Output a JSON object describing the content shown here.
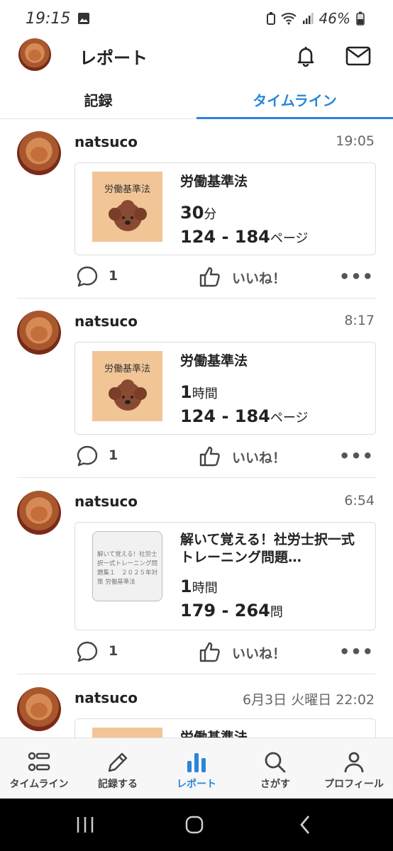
{
  "status_bar": {
    "time": "19:15",
    "battery": "46%"
  },
  "app_bar": {
    "title": "レポート",
    "icons": [
      "bell-icon",
      "mail-icon"
    ]
  },
  "tabs": [
    {
      "label": "記録",
      "active": false
    },
    {
      "label": "タイムライン",
      "active": true
    }
  ],
  "posts": [
    {
      "username": "natsuco",
      "time": "19:05",
      "cover_title": "労働基準法",
      "book_title": "労働基準法",
      "duration_value": "30",
      "duration_unit": "分",
      "range": "124 - 184",
      "range_unit": "ページ",
      "comments": "1",
      "like_label": "いいね！"
    },
    {
      "username": "natsuco",
      "time": "8:17",
      "cover_title": "労働基準法",
      "book_title": "労働基準法",
      "duration_value": "1",
      "duration_unit": "時間",
      "range": "124 - 184",
      "range_unit": "ページ",
      "comments": "1",
      "like_label": "いいね！"
    },
    {
      "username": "natsuco",
      "time": "6:54",
      "cover_title": "解いて覚える！社労士択一式トレーニング問題集１　２０２５年対策 労働基準法",
      "book_title": "解いて覚える！社労士択一式トレーニング問題…",
      "duration_value": "1",
      "duration_unit": "時間",
      "range": "179 - 264",
      "range_unit": "問",
      "comments": "1",
      "like_label": "いいね！"
    },
    {
      "username": "natsuco",
      "time": "6月3日 火曜日 22:02",
      "cover_title": "",
      "book_title": "労働基準法",
      "duration_value": "",
      "duration_unit": "",
      "range": "",
      "range_unit": "",
      "comments": "",
      "like_label": ""
    }
  ],
  "bottom_nav": [
    {
      "label": "タイムライン",
      "icon": "timeline-list-icon",
      "active": false
    },
    {
      "label": "記録する",
      "icon": "pencil-icon",
      "active": false
    },
    {
      "label": "レポート",
      "icon": "bar-chart-icon",
      "active": true
    },
    {
      "label": "さがす",
      "icon": "search-icon",
      "active": false
    },
    {
      "label": "プロフィール",
      "icon": "person-icon",
      "active": false
    }
  ],
  "colors": {
    "accent": "#2a86d8",
    "text": "#222222",
    "cover_bg": "#f2c596"
  }
}
